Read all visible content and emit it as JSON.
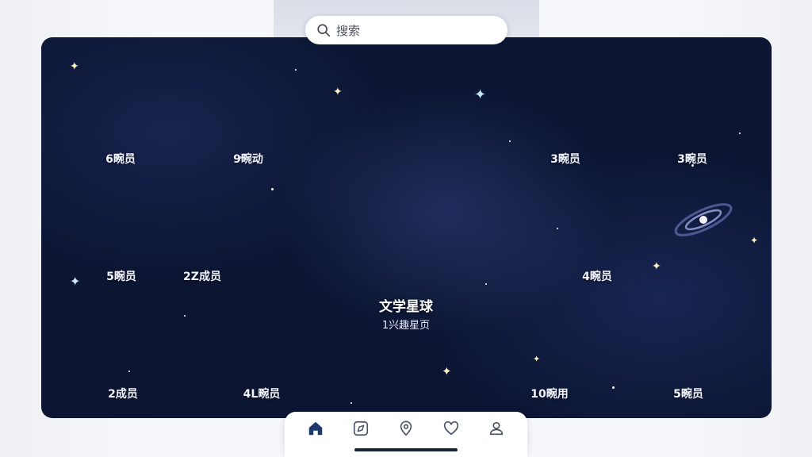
{
  "search": {
    "placeholder": "搜索"
  },
  "center_planet": {
    "title": "文学星球",
    "subtitle": "1兴趣星页",
    "icon": "camera-icon"
  },
  "planets": [
    {
      "id": "p1",
      "label": "6畹员",
      "icon": "book-icon"
    },
    {
      "id": "p2",
      "label": "9畹动",
      "icon": "camera-icon"
    },
    {
      "id": "p3",
      "label": "3畹员",
      "icon": "music-note-icon"
    },
    {
      "id": "p4",
      "label": "3畹员",
      "icon": "music-note-icon"
    },
    {
      "id": "p5",
      "label": "5畹员",
      "icon": "music-note-icon"
    },
    {
      "id": "p6",
      "label": "2Z成员",
      "icon": "music-note-icon"
    },
    {
      "id": "p7",
      "label": "4畹员",
      "icon": "music-note-icon"
    },
    {
      "id": "p8",
      "label": "2成员",
      "icon": "none"
    },
    {
      "id": "p9",
      "label": "4L畹员",
      "icon": "none"
    },
    {
      "id": "p10",
      "label": "10畹用",
      "icon": "music-note-icon"
    },
    {
      "id": "p11",
      "label": "5畹员",
      "icon": "music-note-icon"
    }
  ],
  "tabbar": {
    "items": [
      {
        "name": "home",
        "icon": "home-icon",
        "active": true
      },
      {
        "name": "explore",
        "icon": "compass-icon",
        "active": false
      },
      {
        "name": "location",
        "icon": "location-icon",
        "active": false
      },
      {
        "name": "favorites",
        "icon": "heart-icon",
        "active": false
      },
      {
        "name": "profile",
        "icon": "user-icon",
        "active": false
      }
    ]
  },
  "colors": {
    "space_background": "#0c1633",
    "tab_active": "#1b3a6b",
    "tab_inactive": "#4a5366",
    "label_text": "#f2f4ff"
  }
}
